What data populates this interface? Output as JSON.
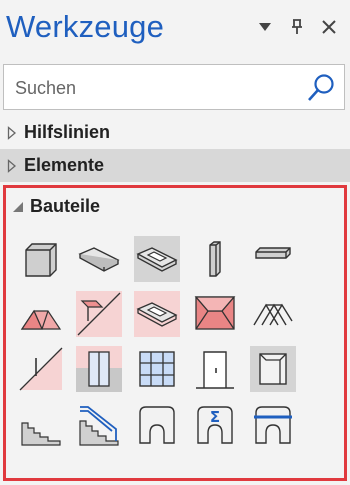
{
  "panel": {
    "title": "Werkzeuge"
  },
  "search": {
    "placeholder": "Suchen"
  },
  "categories": [
    {
      "label": "Hilfslinien",
      "expanded": false
    },
    {
      "label": "Elemente",
      "expanded": false
    },
    {
      "label": "Bauteile",
      "expanded": true
    }
  ],
  "tools": [
    {
      "icon": "cube-block-icon"
    },
    {
      "icon": "slab-icon"
    },
    {
      "icon": "slab-opening-icon"
    },
    {
      "icon": "column-icon"
    },
    {
      "icon": "beam-icon"
    },
    {
      "icon": "roof-icon"
    },
    {
      "icon": "roof-slab-icon"
    },
    {
      "icon": "roof-opening-icon"
    },
    {
      "icon": "hip-roof-icon"
    },
    {
      "icon": "truss-icon"
    },
    {
      "icon": "diagonal-wall-icon"
    },
    {
      "icon": "window-icon"
    },
    {
      "icon": "curtain-wall-icon"
    },
    {
      "icon": "door-icon"
    },
    {
      "icon": "niche-icon"
    },
    {
      "icon": "stairs-icon"
    },
    {
      "icon": "stair-railing-icon"
    },
    {
      "icon": "arch-opening-icon"
    },
    {
      "icon": "sum-opening-icon"
    },
    {
      "icon": "lintel-opening-icon"
    }
  ],
  "colors": {
    "accent": "#1f5fbf",
    "highlight": "#e0393e",
    "fill_pink": "#f4c2c2",
    "fill_gray": "#c8c8c8"
  }
}
